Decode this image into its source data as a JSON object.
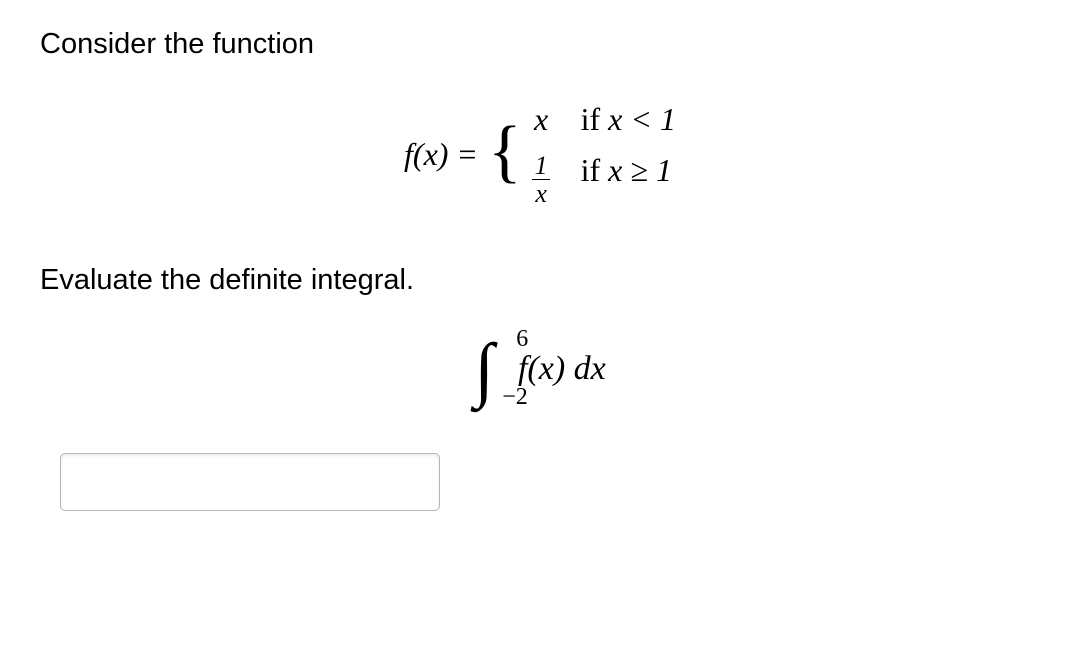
{
  "intro": "Consider the function",
  "piecewise": {
    "lhs": "f(x) = ",
    "case1_val": "x",
    "case1_cond_prefix": "if ",
    "case1_cond_expr": "x < 1",
    "case2_frac_num": "1",
    "case2_frac_den": "x",
    "case2_cond_prefix": "if ",
    "case2_cond_expr": "x ≥ 1"
  },
  "instruction": "Evaluate the definite integral.",
  "integral": {
    "upper": "6",
    "lower": "−2",
    "integrand": "f(x) dx"
  },
  "answer": {
    "value": "",
    "placeholder": ""
  }
}
